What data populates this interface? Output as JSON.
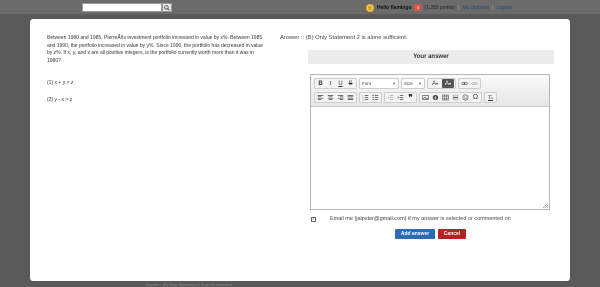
{
  "topbar": {
    "search_placeholder": "",
    "greeting": "Hello flamingo",
    "badge": "3",
    "points": "(1,282 points)",
    "my_updates": "My Updates",
    "logout": "Logout",
    "separator": "|"
  },
  "question": {
    "text": "Between 1980 and 1985, PierreÃ¢s investment portfolio increased in value by x%. Between 1985 and 1990, the portfolio increased in value by y%. Since 1990, the portfolio has decreased in value by z%. If x, y, and z are all positive integers, is the portfolio currently worth more than it was in 1980?",
    "statement1": "(1) x + y > z",
    "statement2": "(2) y - x > z"
  },
  "answer": {
    "text": "Answer :: (B) Only Statement 2 is alone sufficient.",
    "your_answer_title": "Your answer"
  },
  "editor": {
    "font_label": "Font",
    "size_label": "Size",
    "content": ""
  },
  "email_notice": "Email me (jalpster@gmail.com) if my answer is selected or commented on",
  "buttons": {
    "add": "Add answer",
    "cancel": "Cancel"
  },
  "behind_text": "Answer : (B) Only Statement 2 is alone sufficient."
}
